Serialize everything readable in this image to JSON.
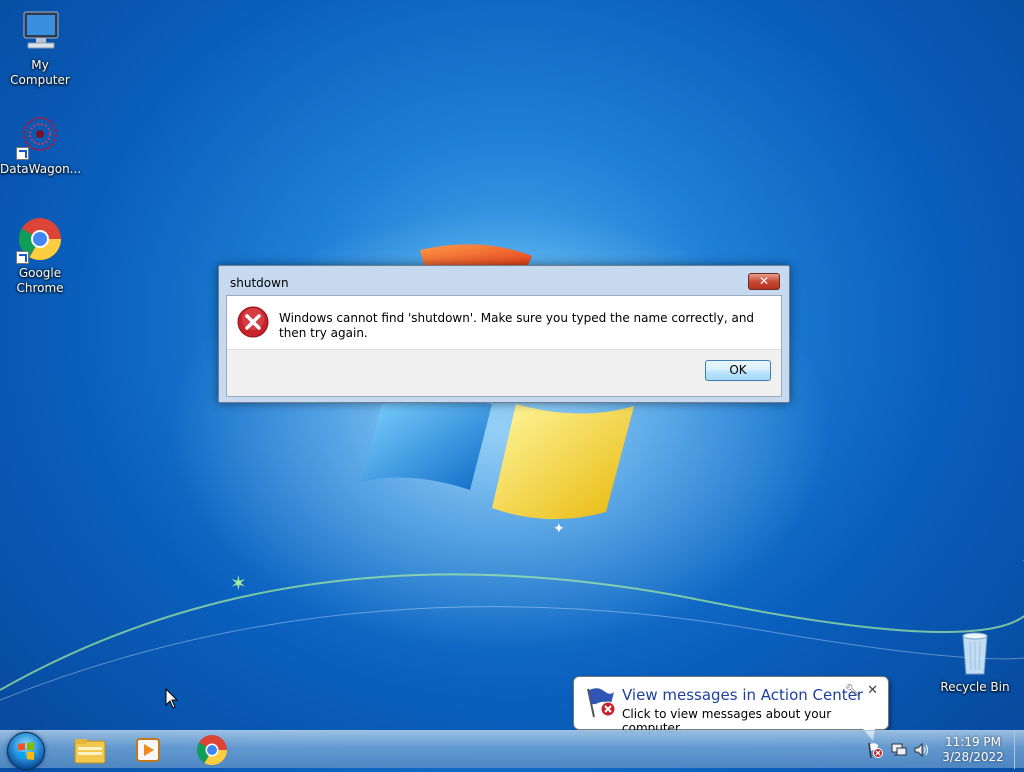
{
  "desktop": {
    "icons": [
      {
        "label": "My Computer",
        "icon": "computer-icon"
      },
      {
        "label": "DataWagon...",
        "icon": "datawagon-icon"
      },
      {
        "label": "Google Chrome",
        "icon": "chrome-icon"
      },
      {
        "label": "Recycle Bin",
        "icon": "recycle-bin-icon"
      }
    ]
  },
  "dialog": {
    "title": "shutdown",
    "message": "Windows cannot find 'shutdown'. Make sure you typed the name correctly, and then try again.",
    "ok_label": "OK",
    "close_glyph": "✕",
    "icon": "error-icon"
  },
  "balloon": {
    "title": "View messages in Action Center",
    "text": "Click to view messages about your computer.",
    "close_glyph": "✕",
    "icon": "action-center-flag-icon"
  },
  "taskbar": {
    "pinned": [
      "windows-explorer-icon",
      "media-player-icon",
      "chrome-icon"
    ],
    "tray_icons": [
      "action-center-icon",
      "network-icon",
      "volume-icon"
    ],
    "time": "11:19 PM",
    "date": "3/28/2022"
  },
  "colors": {
    "desktop_blue": "#0a5fbd",
    "error_red": "#c8232c",
    "link_blue": "#1e3f9f"
  }
}
